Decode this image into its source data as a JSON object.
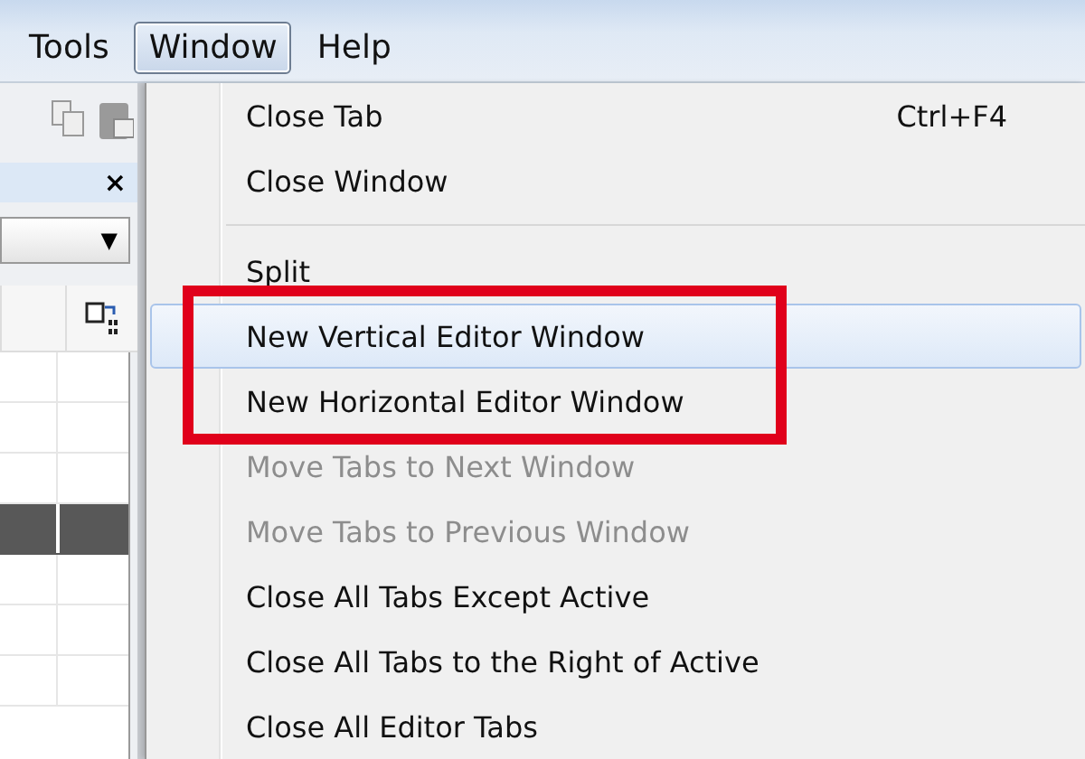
{
  "menubar": [
    {
      "label": "Tools",
      "selected": false
    },
    {
      "label": "Window",
      "selected": true
    },
    {
      "label": "Help",
      "selected": false
    }
  ],
  "panel": {
    "close": "×",
    "dropdown_arrow": "▼",
    "grid_rows": [
      {
        "selected": false
      },
      {
        "selected": false
      },
      {
        "selected": false
      },
      {
        "selected": true
      },
      {
        "selected": false
      },
      {
        "selected": false
      },
      {
        "selected": false
      }
    ]
  },
  "menu": {
    "items": [
      {
        "kind": "item",
        "label": "Close Tab",
        "shortcut": "Ctrl+F4",
        "disabled": false,
        "selected": false
      },
      {
        "kind": "item",
        "label": "Close Window",
        "disabled": false,
        "selected": false
      },
      {
        "kind": "separator"
      },
      {
        "kind": "item",
        "label": "Split",
        "disabled": false,
        "selected": false
      },
      {
        "kind": "item",
        "label": "New Vertical Editor Window",
        "disabled": false,
        "selected": true,
        "annotated": true
      },
      {
        "kind": "item",
        "label": "New Horizontal Editor Window",
        "disabled": false,
        "selected": false,
        "annotated": true
      },
      {
        "kind": "item",
        "label": "Move Tabs to Next Window",
        "disabled": true,
        "selected": false
      },
      {
        "kind": "item",
        "label": "Move Tabs to Previous Window",
        "disabled": true,
        "selected": false
      },
      {
        "kind": "item",
        "label": "Close All Tabs Except Active",
        "disabled": false,
        "selected": false
      },
      {
        "kind": "item",
        "label": "Close All Tabs to the Right of Active",
        "disabled": false,
        "selected": false
      },
      {
        "kind": "item",
        "label": "Close All Editor Tabs",
        "disabled": false,
        "selected": false
      }
    ]
  }
}
